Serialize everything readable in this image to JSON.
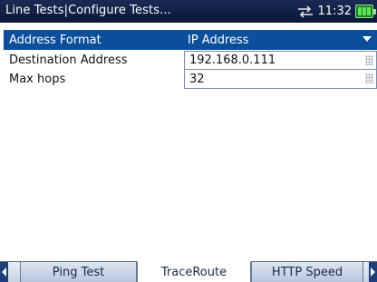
{
  "header": {
    "title": "Line Tests|Configure Tests...",
    "time": "11:32",
    "icons": [
      "connection-icon",
      "battery-icon"
    ]
  },
  "settings": {
    "header_label": "Address Format",
    "header_value": "IP Address",
    "rows": [
      {
        "label": "Destination Address",
        "value": "192.168.0.111"
      },
      {
        "label": "Max hops",
        "value": "32"
      }
    ]
  },
  "tabs": {
    "items": [
      {
        "label": "Ping Test"
      },
      {
        "label": "TraceRoute"
      },
      {
        "label": "HTTP Speed"
      }
    ],
    "active": "TraceRoute"
  },
  "colors": {
    "title_bar": "#0a1736",
    "header_row": "#0b4f9a",
    "accent": "#1d3e7a"
  }
}
